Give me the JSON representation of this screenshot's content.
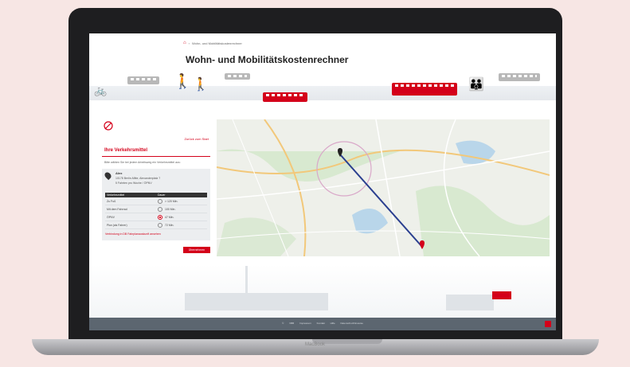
{
  "device": {
    "brand_label": "MacBook"
  },
  "header": {
    "breadcrumb": {
      "current": "Wohn- und Mobilitätskostenrechner"
    },
    "title": "Wohn- und Mobilitätskostenrechner"
  },
  "panel": {
    "back_link": "Zurück zum Start",
    "heading": "Ihre Verkehrsmittel",
    "intro": "Bitte wählen Sie bei jedem Arbeitsweg ein Verkehrsmittel aus:",
    "address": {
      "label": "Alex",
      "line1": "10178 Berlin-Mitte, Alexanderplatz 7",
      "line2": "5 Fahrten pro Woche / ÖPNV"
    },
    "table": {
      "col_mode": "Verkehrsmittel",
      "col_time": "Dauer",
      "rows": [
        {
          "mode": "Zu Fuß",
          "time": "> 120 Min.",
          "selected": false
        },
        {
          "mode": "Mit dem Fahrrad",
          "time": "100 Min.",
          "selected": false
        },
        {
          "mode": "ÖPNV",
          "time": "47 Min.",
          "selected": true
        },
        {
          "mode": "Pkw (als Fahrer)",
          "time": "72 Min.",
          "selected": false
        }
      ]
    },
    "compare_link": "Verbindung in DB Fahrplanauskunft ansehen",
    "apply_button": "Übernehmen"
  },
  "footer": {
    "links_text": "© VBB   Impressum   Kontakt   Hilfe   Datenschutzhinweise"
  },
  "colors": {
    "accent": "#d4001a",
    "footer": "#5c6670",
    "route": "#2a3f8f"
  }
}
